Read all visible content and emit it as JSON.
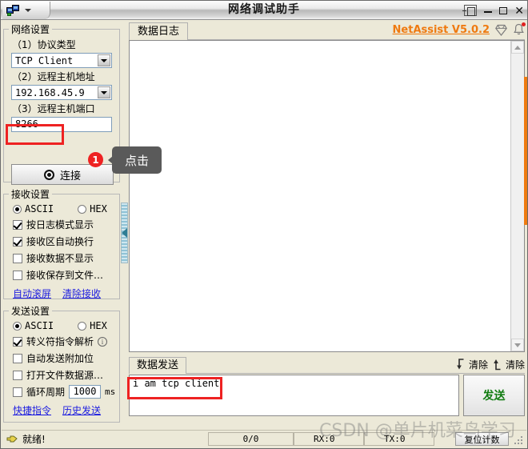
{
  "window": {
    "title": "网络调试助手",
    "app_icon": "network-monitor-icon",
    "menu_caret": "chevron-down-icon",
    "pin_label": "pin-icon",
    "minimize_label": "minimize-icon",
    "maximize_label": "maximize-icon",
    "close_label": "✕",
    "accent_orange": "#ef7a10"
  },
  "network_settings": {
    "legend": "网络设置",
    "protocol_label": "（1）协议类型",
    "protocol_value": "TCP Client",
    "host_label": "（2）远程主机地址",
    "host_value": "192.168.45.9",
    "port_label": "（3）远程主机端口",
    "port_value": "8266",
    "connect_label": "连接"
  },
  "receive_settings": {
    "legend": "接收设置",
    "ascii_label": "ASCII",
    "hex_label": "HEX",
    "mode": "ASCII",
    "checkboxes": [
      {
        "label": "按日志模式显示",
        "checked": true
      },
      {
        "label": "接收区自动换行",
        "checked": true
      },
      {
        "label": "接收数据不显示",
        "checked": false
      },
      {
        "label": "接收保存到文件…",
        "checked": false
      }
    ],
    "links": [
      "自动滚屏",
      "清除接收"
    ]
  },
  "send_settings": {
    "legend": "发送设置",
    "ascii_label": "ASCII",
    "hex_label": "HEX",
    "mode": "ASCII",
    "checkboxes": [
      {
        "label": "转义符指令解析",
        "checked": true
      },
      {
        "label": "自动发送附加位",
        "checked": false
      },
      {
        "label": "打开文件数据源…",
        "checked": false
      }
    ],
    "period_label": "循环周期",
    "period_value": "1000",
    "period_unit": "ms",
    "period_checked": false,
    "links": [
      "快捷指令",
      "历史发送"
    ]
  },
  "log_panel": {
    "tab_label": "数据日志",
    "brand": "NetAssist V5.0.2",
    "diamond_icon": "diamond-icon",
    "bell_icon": "bell-icon",
    "content": ""
  },
  "send_panel": {
    "tab_label": "数据发送",
    "clear_down_label": "清除",
    "clear_up_label": "清除",
    "input_value": "i am tcp client",
    "send_label": "发送"
  },
  "status_bar": {
    "ready_text": "就绪!",
    "ratio": "0/0",
    "rx": "RX:0",
    "tx": "TX:0",
    "reset_label": "复位计数"
  },
  "annotations": {
    "badge_1": "1",
    "tooltip_1": "点击",
    "watermark": "CSDN @单片机菜鸟学习"
  }
}
